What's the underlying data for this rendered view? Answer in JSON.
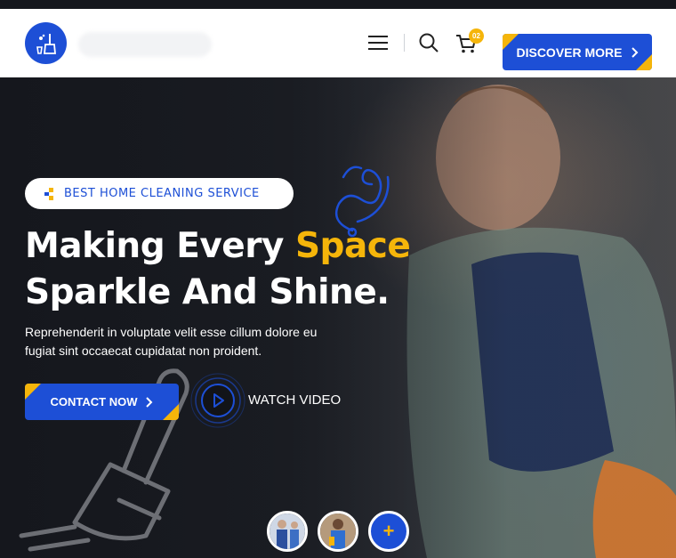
{
  "header": {
    "cart_count": "02",
    "discover_label": "DISCOVER MORE",
    "icons": [
      "logo-icon",
      "menu-icon",
      "search-icon",
      "cart-icon",
      "chevron-right-icon"
    ]
  },
  "hero": {
    "tag": "BEST HOME CLEANING SERVICE",
    "title_line1_prefix": "Making Every ",
    "title_line1_accent": "Space",
    "title_line2": "Sparkle And Shine.",
    "description": "Reprehenderit in voluptate velit esse cillum dolore eu fugiat sint occaecat cupidatat non proident.",
    "contact_label": "CONTACT NOW",
    "watch_label": "WATCH VIDEO",
    "plus_label": "+"
  },
  "colors": {
    "primary": "#1d4fd6",
    "accent": "#f5b50a",
    "dark": "#1c1e24",
    "white": "#ffffff"
  }
}
